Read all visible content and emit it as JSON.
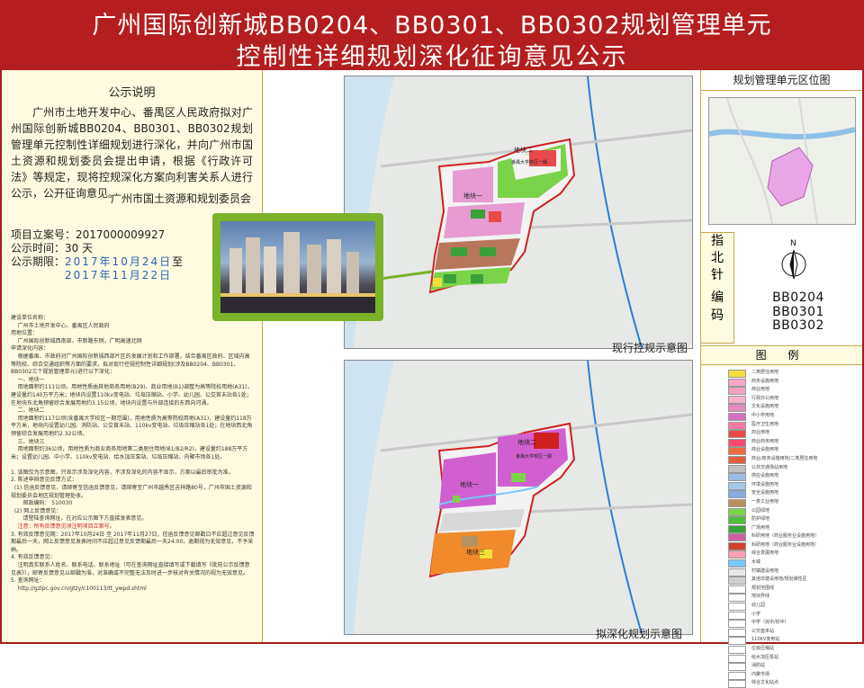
{
  "header": {
    "title_line1": "广州国际创新城BB0204、BB0301、BB0302规划管理单元",
    "title_line2": "控制性详细规划深化征询意见公示"
  },
  "left": {
    "heading": "公示说明",
    "notice": "广州市土地开发中心、番禺区人民政府拟对广州国际创新城BB0204、BB0301、BB0302规划管理单元控制性详细规划进行深化，并向广州市国土资源和规划委员会提出申请，根据《行政许可法》等规定，现将控规深化方案向利害关系人进行公示，公开征询意见。",
    "signature": "广州市国土资源和规划委员会",
    "project_no_label": "项目立案号：",
    "project_no": "2017000009927",
    "duration_label": "公示时间：",
    "duration": "30 天",
    "period_label": "公示期限：",
    "period_from": "2017年10月24日",
    "period_to_word": "至",
    "period_to": "2017年11月22日",
    "fine_print_1": "建设单位名称：\n    广州市土地开发中心、番禺区人民政府\n用地位置：\n    广州国际创新城西南部，市新路东侧，广明高速北侧\n申请深化内容：\n    根据番禺、市政府对广州国际创新城西部片区的发展计划和工作部署，结合番禺区政府、区域内高等院校、综合交通组织等方面的要求，拟对现行控规控制性详细规划(涉及BB0204、BB0301、BB0302三个规划管理单元)进行以下深化：\n    一、地块一\n    用地面积约111公顷，用地性质由其他商务用地(B29)、商业用地(B1)调整为高等院校用地(A31)，建设量约140万平方米；地块内设置110kv变电站、垃圾压缩站、小学、幼儿园、公交首末站各1处；在地块东北角预留综合发展用地约3.15公顷，地块内设置与外部连接的东西向河涌。\n    二、地块二\n    用地面积约117公顷(含番禺大学校区一期范围)，用地性质为高等院校用地(A31)，建设量约118万平方米，地块内设置幼儿园、消防站、公交首末站、110kv变电站、垃圾压缩站各1处；在地块西北角预留综合发展用地约2.32公顷。\n    三、地块三\n    用地面积约36公顷，用地性质为商业商务用地第二类居住用地(B1/B2/R2)，建设量约188万平方米；设置幼儿园、中小学、110kv变电站、给水加压泵站、垃圾压缩站、内聚市场各1处。\n\n1. 该图仅为示意图，只显示涉及深化内容，不涉及深化的内容不显示，方案以最后审批为准。\n2. 陈述申辩意见反馈方式：\n  (1) 信函反馈意见，请邮寄至信函反馈意见，请邮寄至广州市越秀区吉祥路80号，广州市国土资源和规划委员会地区规划管理处收。\n       邮政编码： 510030\n  (2) 网上反馈意见：\n       请登陆查询网址，在对应公示图下方直接发表意见。\n",
    "fine_print_red": "    注意：所有反馈意见须注明项目立案号。",
    "fine_print_2": "\n3. 有效反馈意见期：2017年10月24日 至 2017年11月27日，信函反馈意见邮戳日不应超过意见反馈期最后一天，网上反馈意见发表时间不应超过意见反馈期最后一天24:00，逾期视为无效意见，不予采纳。\n4. 有效反馈意见：\n    注明真实联系人姓名、联系电话、联系地址（可在查询网址直接填写或下载填写《批前公示反馈意见表》），邮寄反馈意见以邮戳为准，对准确或不完整无法及时进一步核对有关情况的视为无效意见。\n5. 查询网址：\n    http://gzlpc.gov.cn/gtzy/c100113/tt_ywpd.shtml"
  },
  "middle": {
    "current_map_caption": "现行控规示意图",
    "proposed_map_caption": "拟深化规划示意图",
    "map_labels": {
      "plot1": "地块一",
      "plot2": "地块二",
      "plot3": "地块三",
      "campus": "番禺大学校区一期"
    }
  },
  "right": {
    "location_title": "规划管理单元区位图",
    "compass_label": [
      "指",
      "北",
      "针"
    ],
    "compass_n": "N",
    "code_label": [
      "编",
      "",
      "码"
    ],
    "codes": [
      "BB0204",
      "BB0301",
      "BB0302"
    ],
    "legend_title": "图  例",
    "legend": [
      {
        "color": "#f3e03a",
        "label": "二类居住用地"
      },
      {
        "color": "#f7a6c8",
        "label": "商务设施用地"
      },
      {
        "color": "#f2a2c0",
        "label": "商业用地"
      },
      {
        "color": "#f7b0d0",
        "label": "行政办公用地"
      },
      {
        "color": "#e08cc0",
        "label": "文化设施用地"
      },
      {
        "color": "#d470c0",
        "label": "中小学用地"
      },
      {
        "color": "#ff7aa8",
        "label": "医疗卫生用地"
      },
      {
        "color": "#e84a4a",
        "label": "商业用地"
      },
      {
        "color": "#ff4a70",
        "label": "商业商务用地"
      },
      {
        "color": "#f06a3a",
        "label": "商业设施用地"
      },
      {
        "color": "#e06040",
        "label": "商业/商务设施用地/二类居住用地"
      },
      {
        "color": "#c0c0c0",
        "label": "公共交通场站用地"
      },
      {
        "color": "#9fbce0",
        "label": "供应设施用地"
      },
      {
        "color": "#a6c8e8",
        "label": "环境设施用地"
      },
      {
        "color": "#88aadd",
        "label": "安全设施用地"
      },
      {
        "color": "#b59060",
        "label": "一类工业用地"
      },
      {
        "color": "#7bd34a",
        "label": "公园绿地"
      },
      {
        "color": "#4fbf3a",
        "label": "防护绿地"
      },
      {
        "color": "#3aa03a",
        "label": "广场用地"
      },
      {
        "color": "#d060a0",
        "label": "科研用地（商业服务业设施用地）"
      },
      {
        "color": "#d24030",
        "label": "科研用地（商业服务业设施用地）"
      },
      {
        "color": "#ff9fb8",
        "label": "综合发展用地"
      },
      {
        "color": "#79c7ff",
        "label": "水域"
      },
      {
        "color": "#e8e8e8",
        "label": "村镇建设用地"
      },
      {
        "color": "#cfcfcf",
        "label": "其他非建设用地/规划弹性区"
      },
      {
        "color": "#ffffff",
        "label": "规划范围线"
      },
      {
        "color": "#ffffff",
        "label": "地块界线"
      },
      {
        "color": "#ffffff",
        "label": "幼儿园"
      },
      {
        "color": "#ffffff",
        "label": "小学"
      },
      {
        "color": "#ffffff",
        "label": "中学（完中/初中）"
      },
      {
        "color": "#ffffff",
        "label": "公交首末站"
      },
      {
        "color": "#ffffff",
        "label": "110KV变电站"
      },
      {
        "color": "#ffffff",
        "label": "垃圾压缩站"
      },
      {
        "color": "#ffffff",
        "label": "给水加压泵站"
      },
      {
        "color": "#ffffff",
        "label": "消防站"
      },
      {
        "color": "#ffffff",
        "label": "内聚市场"
      },
      {
        "color": "#ffffff",
        "label": "综合文化站点"
      }
    ]
  }
}
